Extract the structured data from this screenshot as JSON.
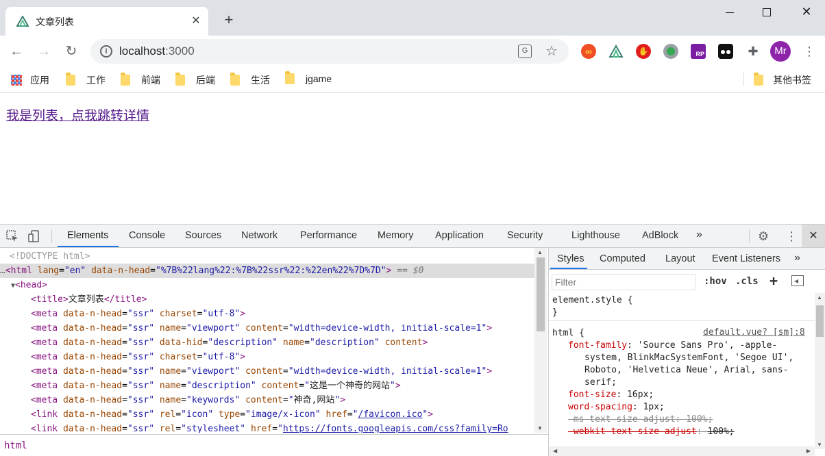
{
  "browser": {
    "tab_title": "文章列表",
    "new_tab_symbol": "+",
    "address": "localhost",
    "port": ":3000",
    "profile_initials": "Mr"
  },
  "bookmarks": {
    "apps": "应用",
    "items": [
      "工作",
      "前端",
      "后端",
      "生活",
      "jgame"
    ],
    "other": "其他书签"
  },
  "page": {
    "link_text": "我是列表，点我跳转详情"
  },
  "devtools": {
    "tabs": [
      "Elements",
      "Console",
      "Sources",
      "Network",
      "Performance",
      "Memory",
      "Application",
      "Security",
      "Lighthouse",
      "AdBlock"
    ],
    "active_tab": "Elements",
    "more": "»",
    "dom_lines": [
      {
        "indent": 0,
        "raw": "<!DOCTYPE html>"
      },
      {
        "indent": 0
      },
      {
        "indent": 0
      },
      {
        "indent": 2
      },
      {
        "indent": 2
      },
      {
        "indent": 2
      },
      {
        "indent": 2
      },
      {
        "indent": 2
      },
      {
        "indent": 2
      },
      {
        "indent": 2
      },
      {
        "indent": 2
      },
      {
        "indent": 2
      },
      {
        "indent": 2
      }
    ],
    "html_line": {
      "tag": "html",
      "attr1": "lang",
      "val1": "en",
      "attr2": "data-n-head",
      "val2": "%7B%22lang%22:%7B%22ssr%22:%22en%22%7D%7D",
      "console_ref": "== $0"
    },
    "head_tag": "head",
    "title_text": "文章列表",
    "meta1": {
      "attr": "data-n-head",
      "val": "ssr",
      "a2": "charset",
      "v2": "utf-8"
    },
    "meta2": {
      "a2": "name",
      "v2": "viewport",
      "a3": "content",
      "v3": "width=device-width, initial-scale=1"
    },
    "meta3": {
      "a2": "data-hid",
      "v2": "description",
      "a3": "name",
      "v3": "description",
      "a4": "content"
    },
    "meta6": {
      "v2": "description",
      "v3": "这是一个神奇的网站"
    },
    "meta7": {
      "v2": "keywords",
      "v3": "神奇,网站"
    },
    "link1": {
      "a2": "rel",
      "v2": "icon",
      "a3": "type",
      "v3": "image/x-icon",
      "a4": "href",
      "v4": "/favicon.ico"
    },
    "link2": {
      "v2": "stylesheet",
      "v4": "https://fonts.googleapis.com/css?family=Ro"
    },
    "breadcrumb": "html",
    "styles_tabs": [
      "Styles",
      "Computed",
      "Layout",
      "Event Listeners"
    ],
    "filter_placeholder": "Filter",
    "hov": ":hov",
    "cls": ".cls",
    "element_style": "element.style {",
    "close_brace": "}",
    "html_rule_selector": "html {",
    "html_rule_source": "default.vue? [sm]:8",
    "props": [
      {
        "name": "font-family",
        "value": "'Source Sans Pro', -apple-",
        "cont": [
          "system, BlinkMacSystemFont, 'Segoe UI',",
          "Roboto, 'Helvetica Neue', Arial, sans-",
          "serif;"
        ]
      },
      {
        "name": "font-size",
        "value": "16px;"
      },
      {
        "name": "word-spacing",
        "value": "1px;"
      },
      {
        "name": "-ms-text-size-adjust",
        "value": "100%;",
        "struck": true
      },
      {
        "name": "-webkit-text-size-adjust",
        "value": "100%;",
        "struck": true
      }
    ]
  },
  "colors": {
    "chrome_bg": "#dee1e6",
    "link_visited": "#551a8b",
    "devtools_accent": "#1a73e8"
  }
}
